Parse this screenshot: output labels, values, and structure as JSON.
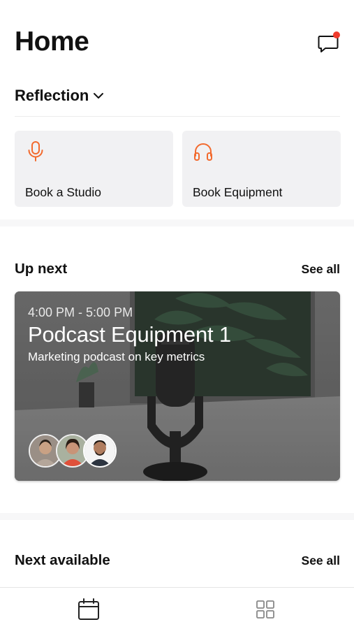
{
  "header": {
    "title": "Home"
  },
  "workspace": {
    "label": "Reflection"
  },
  "quick_actions": [
    {
      "label": "Book a Studio",
      "icon": "microphone-icon"
    },
    {
      "label": "Book Equipment",
      "icon": "headphones-icon"
    }
  ],
  "up_next": {
    "title": "Up next",
    "see_all": "See all",
    "card": {
      "time": "4:00 PM - 5:00 PM",
      "title": "Podcast Equipment 1",
      "subtitle": "Marketing podcast on key metrics",
      "attendees": [
        "attendee-1",
        "attendee-2",
        "attendee-3"
      ]
    }
  },
  "next_available": {
    "title": "Next available",
    "see_all": "See all"
  },
  "tabbar": {
    "tabs": [
      "calendar-icon",
      "grid-icon"
    ]
  },
  "colors": {
    "accent": "#f26a2e",
    "notification": "#ef3b2c",
    "tile": "#f1f1f3"
  }
}
